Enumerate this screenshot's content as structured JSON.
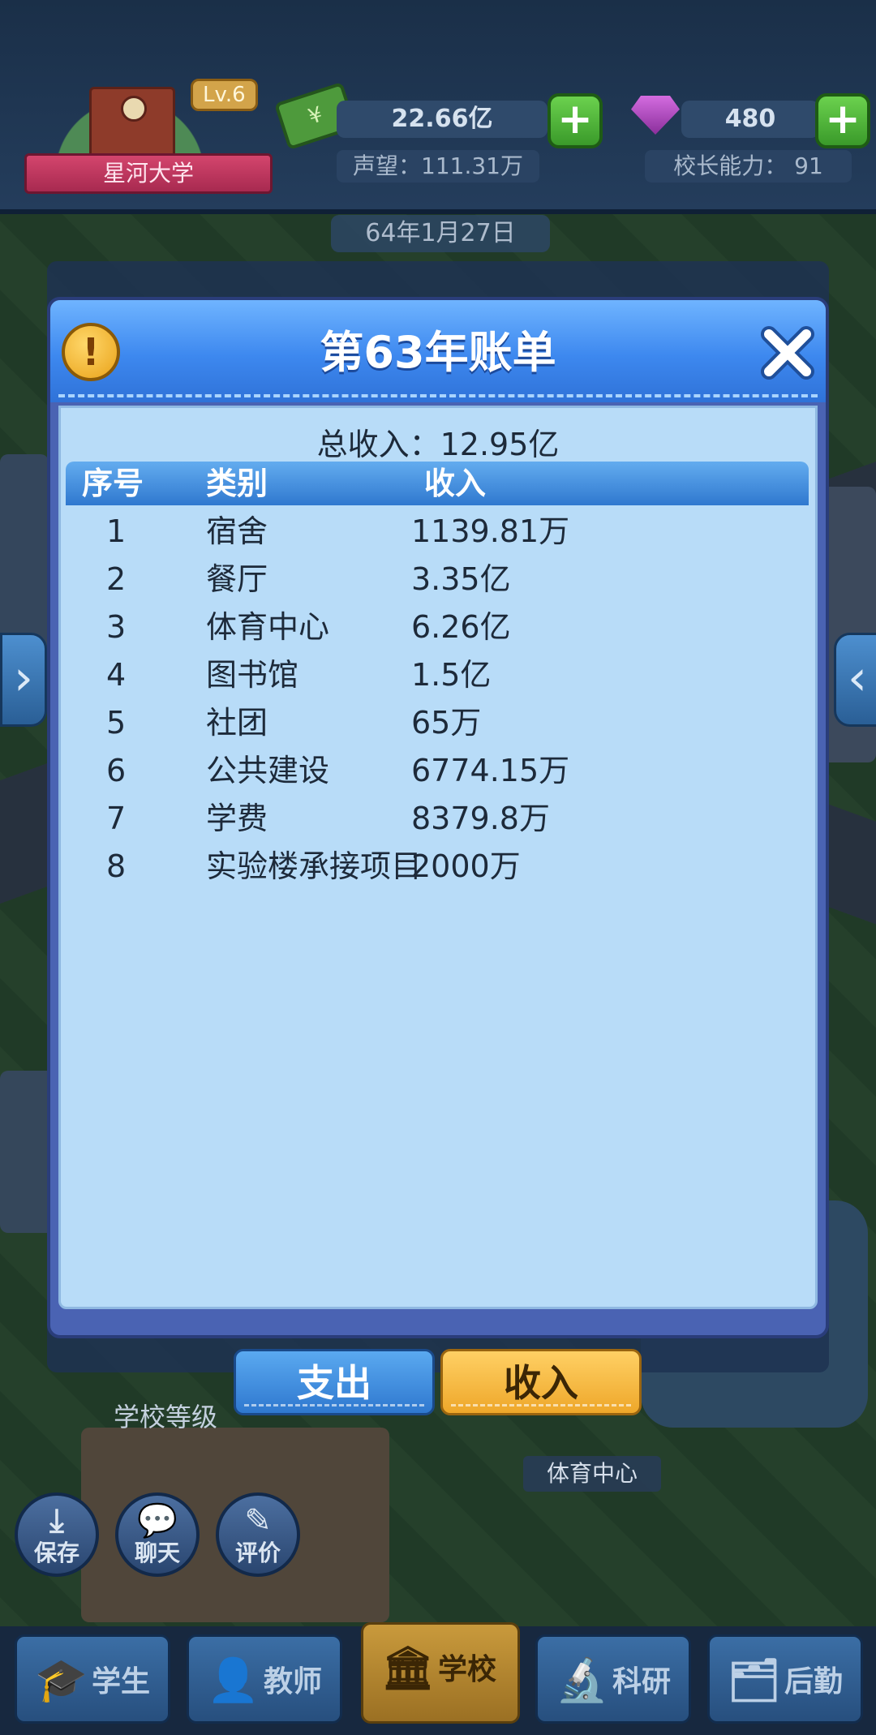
{
  "top_bar": {
    "school": {
      "level": "Lv.6",
      "name": "星河大学"
    },
    "money": {
      "value": "22.66亿"
    },
    "gems": {
      "value": "480"
    },
    "reputation": {
      "text": "声望：111.31万"
    },
    "principal_ability": {
      "text": "校长能力：  91"
    },
    "date": "64年1月27日"
  },
  "dialog": {
    "title": "第63年账单",
    "total": "总收入：12.95亿",
    "columns": [
      "序号",
      "类别",
      "收入"
    ],
    "rows": [
      {
        "no": "1",
        "category": "宿舍",
        "income": "1139.81万"
      },
      {
        "no": "2",
        "category": "餐厅",
        "income": "3.35亿"
      },
      {
        "no": "3",
        "category": "体育中心",
        "income": "6.26亿"
      },
      {
        "no": "4",
        "category": "图书馆",
        "income": "1.5亿"
      },
      {
        "no": "5",
        "category": "社团",
        "income": "65万"
      },
      {
        "no": "6",
        "category": "公共建设",
        "income": "6774.15万"
      },
      {
        "no": "7",
        "category": "学费",
        "income": "8379.8万"
      },
      {
        "no": "8",
        "category": "实验楼承接项目",
        "income": "2000万"
      }
    ]
  },
  "toggle": {
    "expense": "支出",
    "income": "收入"
  },
  "side_buttons": {
    "grade": "学校等级",
    "save": "保存",
    "chat": "聊天",
    "review": "评价"
  },
  "map_label": "体育中心",
  "nav": [
    {
      "label": "学生",
      "icon": "graduation-cap-icon",
      "glyph": "🎓"
    },
    {
      "label": "教师",
      "icon": "teacher-icon",
      "glyph": "👤"
    },
    {
      "label": "学校",
      "icon": "school-icon",
      "glyph": "🏛"
    },
    {
      "label": "科研",
      "icon": "microscope-icon",
      "glyph": "🔬"
    },
    {
      "label": "后勤",
      "icon": "logistics-icon",
      "glyph": "🗂"
    }
  ],
  "colors": {
    "dialog_body": "#b8dcf8",
    "header_blue": "#3d88ef",
    "income_button": "#f2b43a",
    "expense_button": "#3e8fe0"
  }
}
